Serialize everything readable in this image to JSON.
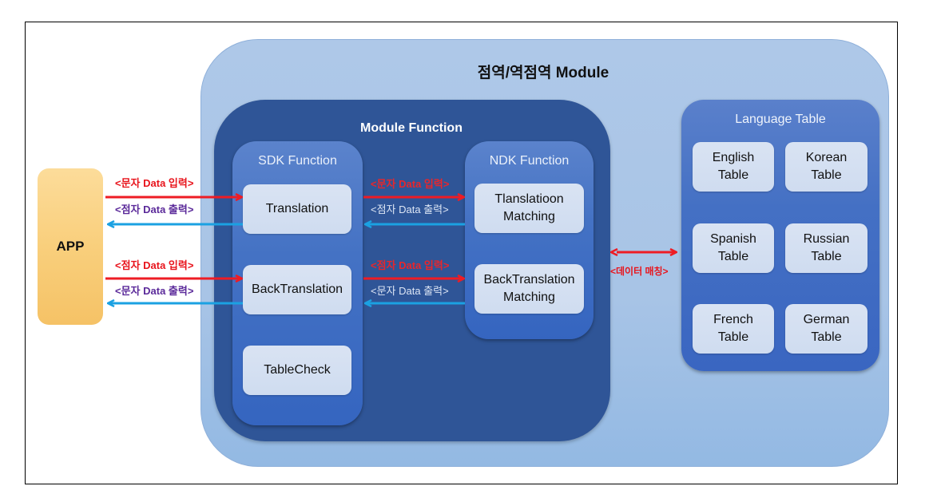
{
  "diagram": {
    "outer_module_title": "점역/역점역 Module",
    "module_function_title": "Module Function",
    "app_label": "APP",
    "sdk": {
      "title": "SDK Function",
      "items": [
        "Translation",
        "BackTranslation",
        "TableCheck"
      ]
    },
    "ndk": {
      "title": "NDK Function",
      "items": [
        {
          "line1": "Tlanslatioon",
          "line2": "Matching"
        },
        {
          "line1": "BackTranslation",
          "line2": "Matching"
        }
      ]
    },
    "language_table": {
      "title": "Language Table",
      "items": [
        {
          "line1": "English",
          "line2": "Table"
        },
        {
          "line1": "Korean",
          "line2": "Table"
        },
        {
          "line1": "Spanish",
          "line2": "Table"
        },
        {
          "line1": "Russian",
          "line2": "Table"
        },
        {
          "line1": "French",
          "line2": "Table"
        },
        {
          "line1": "German",
          "line2": "Table"
        }
      ]
    },
    "arrows": {
      "app_sdk": {
        "in1": "<문자 Data 입력>",
        "out1": "<점자 Data 출력>",
        "in2": "<점자 Data 입력>",
        "out2": "<문자 Data 출력>"
      },
      "sdk_ndk": {
        "in1": "<문자 Data 입력>",
        "out1": "<점자 Data 출력>",
        "in2": "<점자 Data 입력>",
        "out2": "<문자 Data 출력>"
      },
      "data_matching": "<데이터 매칭>"
    },
    "colors": {
      "input_arrow": "#ee1c24",
      "output_arrow": "#1ba1e2",
      "app_fill": "#f9cf7c",
      "module_function_fill": "#2f5597",
      "outer_module_fill": "#aec8e8"
    }
  }
}
